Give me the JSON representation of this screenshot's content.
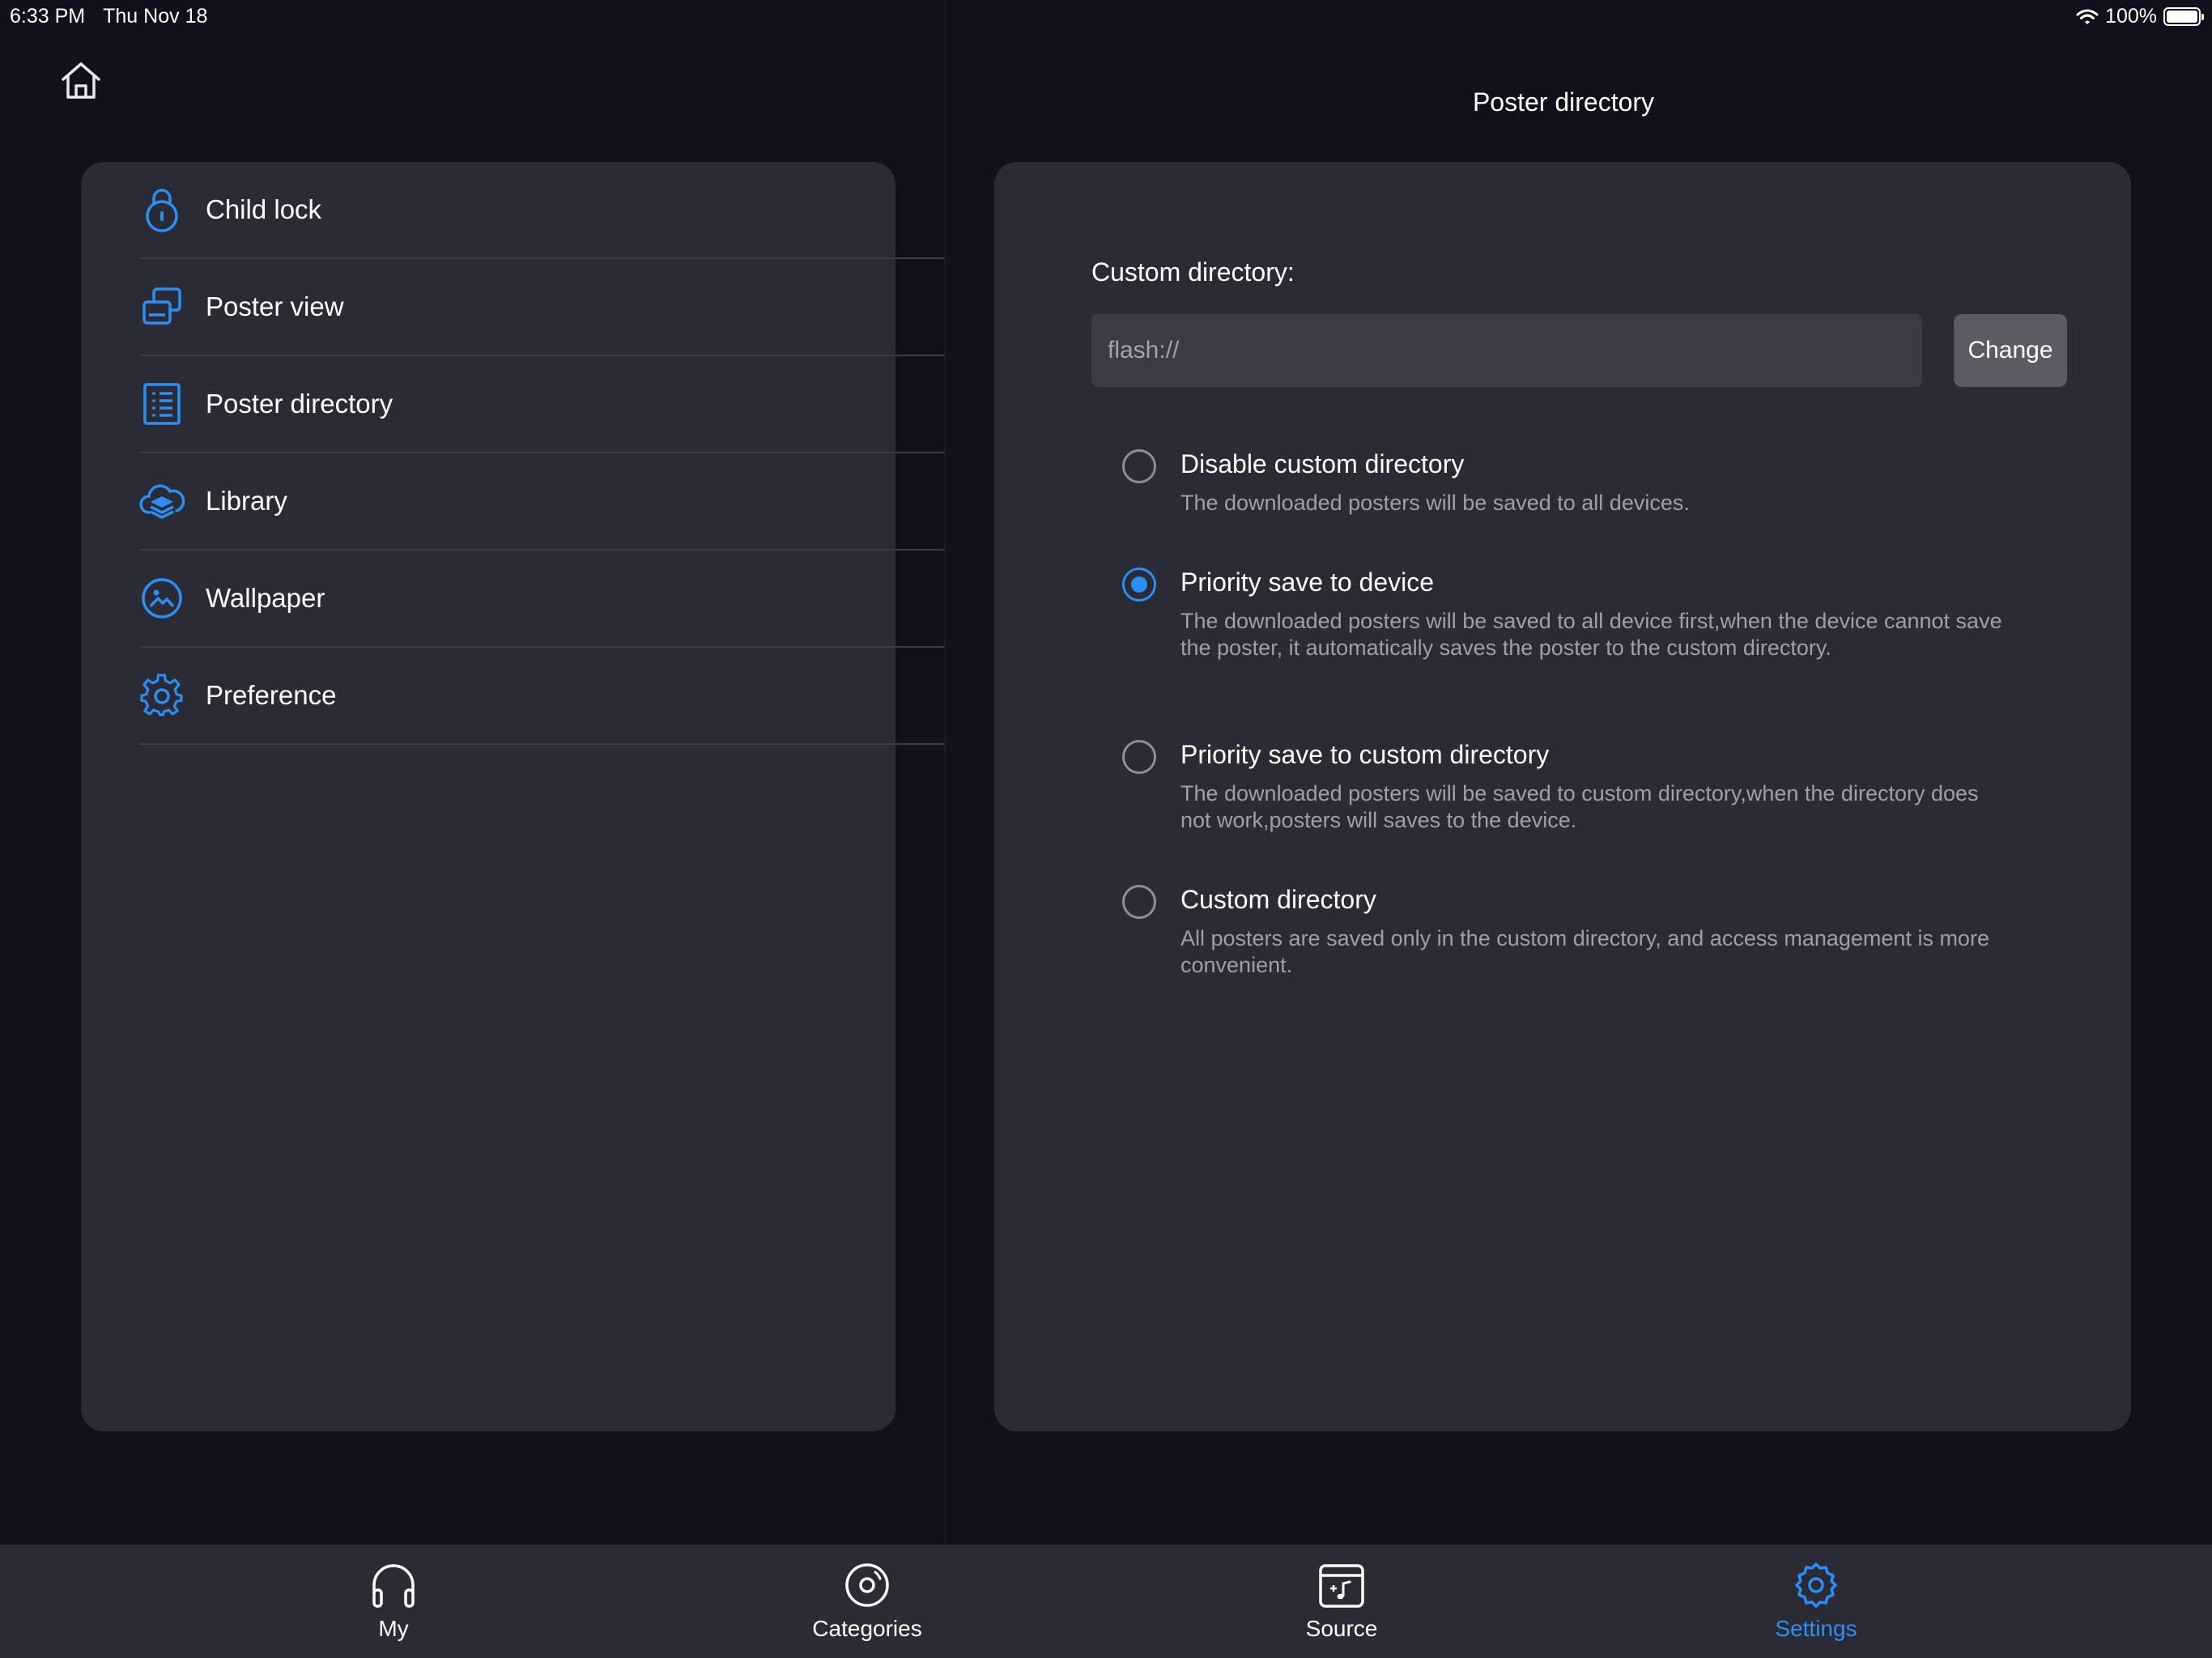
{
  "status_bar": {
    "time": "6:33 PM",
    "date": "Thu Nov 18",
    "battery": "100%",
    "wifi_icon": "wifi-icon",
    "battery_icon": "battery-icon"
  },
  "nav": {
    "home_icon": "home-icon"
  },
  "sidebar": {
    "items": [
      {
        "label": "Child lock",
        "icon": "lock-icon"
      },
      {
        "label": "Poster view",
        "icon": "poster-view-icon"
      },
      {
        "label": "Poster directory",
        "icon": "list-icon"
      },
      {
        "label": "Library",
        "icon": "cloud-layers-icon"
      },
      {
        "label": "Wallpaper",
        "icon": "image-icon"
      },
      {
        "label": "Preference",
        "icon": "gear-icon"
      }
    ]
  },
  "detail": {
    "title": "Poster directory",
    "custom_directory_label": "Custom directory:",
    "path_value": "flash://",
    "change_button": "Change",
    "options": [
      {
        "title": "Disable custom directory",
        "description": "The downloaded posters will be saved to all devices.",
        "selected": false
      },
      {
        "title": "Priority save to device",
        "description": "The downloaded posters will be saved to all device first,when the device cannot save the poster, it automatically saves the poster to the custom directory.",
        "selected": true
      },
      {
        "title": "Priority save to custom directory",
        "description": "The downloaded posters will be saved to custom directory,when the directory does not work,posters will saves to the device.",
        "selected": false
      },
      {
        "title": "Custom directory",
        "description": "All posters are saved only in the custom directory, and access management is more convenient.",
        "selected": false
      }
    ]
  },
  "tab_bar": {
    "tabs": [
      {
        "label": "My",
        "icon": "headphones-icon",
        "active": false
      },
      {
        "label": "Categories",
        "icon": "disc-icon",
        "active": false
      },
      {
        "label": "Source",
        "icon": "music-folder-icon",
        "active": false
      },
      {
        "label": "Settings",
        "icon": "gear-icon",
        "active": true
      }
    ]
  },
  "colors": {
    "background": "#10111d",
    "card": "#2b2b35",
    "accent": "#2c8ef8",
    "secondary_text": "#9fa0a7"
  }
}
